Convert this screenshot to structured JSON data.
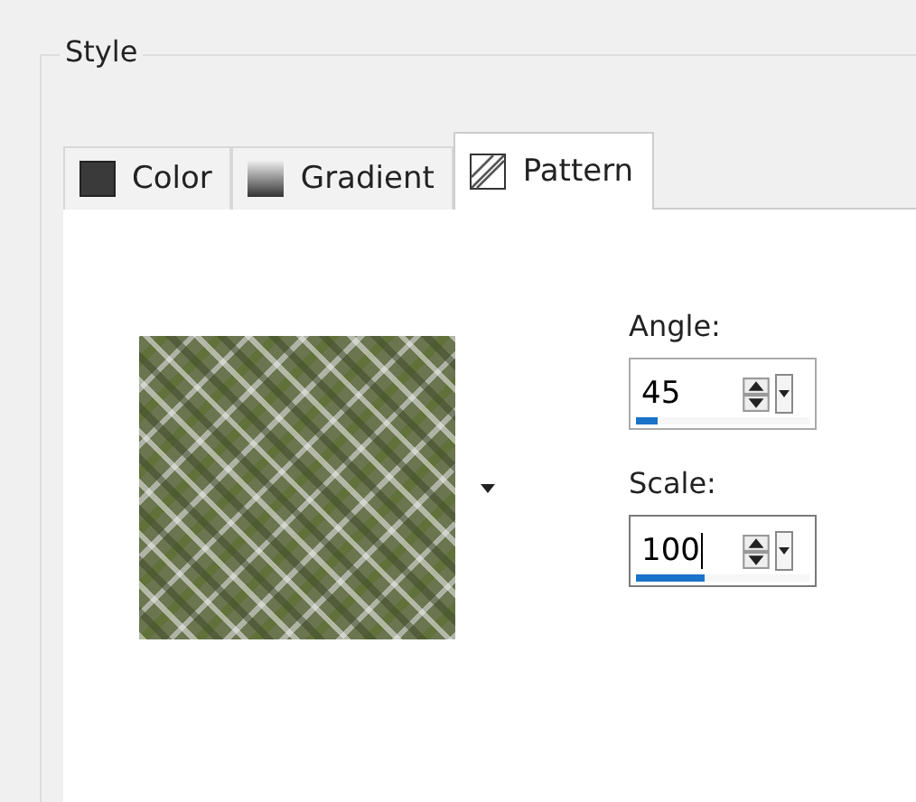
{
  "group": {
    "title": "Style"
  },
  "tabs": [
    {
      "label": "Color",
      "kind": "color",
      "selected": false
    },
    {
      "label": "Gradient",
      "kind": "gradient",
      "selected": false
    },
    {
      "label": "Pattern",
      "kind": "pattern",
      "selected": true
    }
  ],
  "fields": [
    {
      "label": "Angle:",
      "value": "45",
      "level": 0.125,
      "focused": false
    },
    {
      "label": "Scale:",
      "value": "100",
      "level": 0.4,
      "focused": true
    }
  ]
}
